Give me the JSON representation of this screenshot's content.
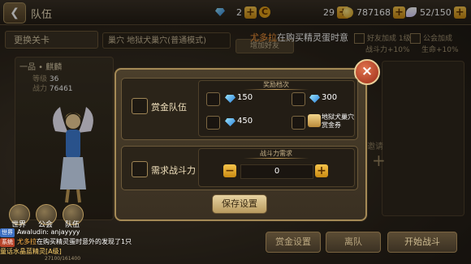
{
  "header": {
    "title": "队伍",
    "gems": "2",
    "energy": "29",
    "coins": "787168",
    "stamina": "52/150"
  },
  "toolbar": {
    "stage_select": "更换关卡",
    "stage_name": "巢穴  地狱犬巢穴(普通模式)",
    "add_friend": "增加好友",
    "buff_friend": "好友加成 1级",
    "buff_friend_sub": "战斗力+10%",
    "buff_guild": "公会加成",
    "buff_guild_sub": "生命+10%"
  },
  "bulletin": {
    "player": "尤多拉",
    "text": "在购买精灵蛋时意"
  },
  "hero": {
    "rank": "一品 • 麒麟",
    "level_label": "等级",
    "level": "36",
    "power_label": "战力",
    "power": "76461"
  },
  "side": {
    "invite": "击邀请"
  },
  "modal": {
    "bounty_label": "赏金队伍",
    "rewards_header": "奖励档次",
    "rewards": [
      "150",
      "300",
      "450",
      "地狱犬巢穴赏金券"
    ],
    "power_label": "需求战斗力",
    "power_header": "战斗力需求",
    "power_value": "0",
    "save": "保存设置",
    "close": "×"
  },
  "channels": [
    "世界",
    "公会",
    "队伍"
  ],
  "buttons": {
    "bounty_settings": "赏金设置",
    "leave": "离队",
    "start": "开始战斗"
  },
  "chat": {
    "tag_world": "世界",
    "msg1_name": "Awaludin:",
    "msg1_text": "anjayyyy",
    "tag_system": "系统",
    "msg2_player": "尤多拉",
    "msg2_text": "在购买精灵蛋时意外的发现了1只",
    "msg2_item": "童话水晶蓝精灵[A级]"
  },
  "exp": "27100/161400",
  "colors": {
    "accent_gold": "#f6c44b",
    "highlight_orange": "#ff9a3a",
    "close_red": "#c0402a"
  }
}
